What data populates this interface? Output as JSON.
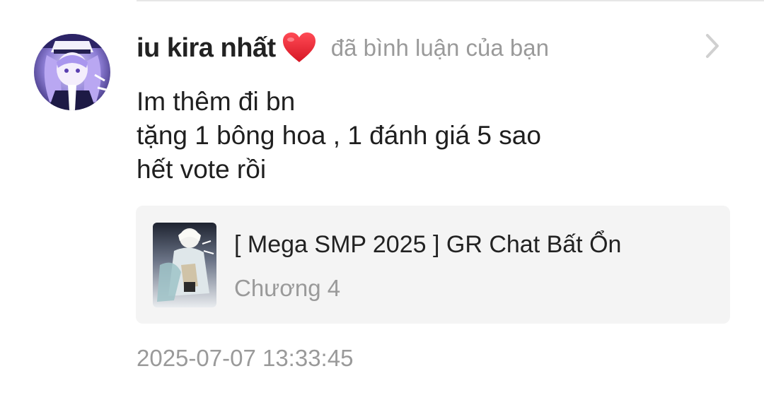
{
  "notification": {
    "username": "iu kira nhất",
    "action": "đã bình luận của bạn",
    "comment_lines": [
      "Im thêm đi bn",
      "tặng 1 bông hoa , 1 đánh giá 5 sao",
      "hết vote rồi"
    ],
    "timestamp": "2025-07-07 13:33:45"
  },
  "story_card": {
    "title": "[ Mega SMP 2025 ] GR Chat Bất Ổn",
    "chapter": "Chương 4"
  },
  "icons": {
    "heart": "heart-icon",
    "chevron": "chevron-right-icon"
  },
  "colors": {
    "heart": "#e8232f",
    "muted_text": "#9a9a9a",
    "card_bg": "#f4f4f4"
  }
}
